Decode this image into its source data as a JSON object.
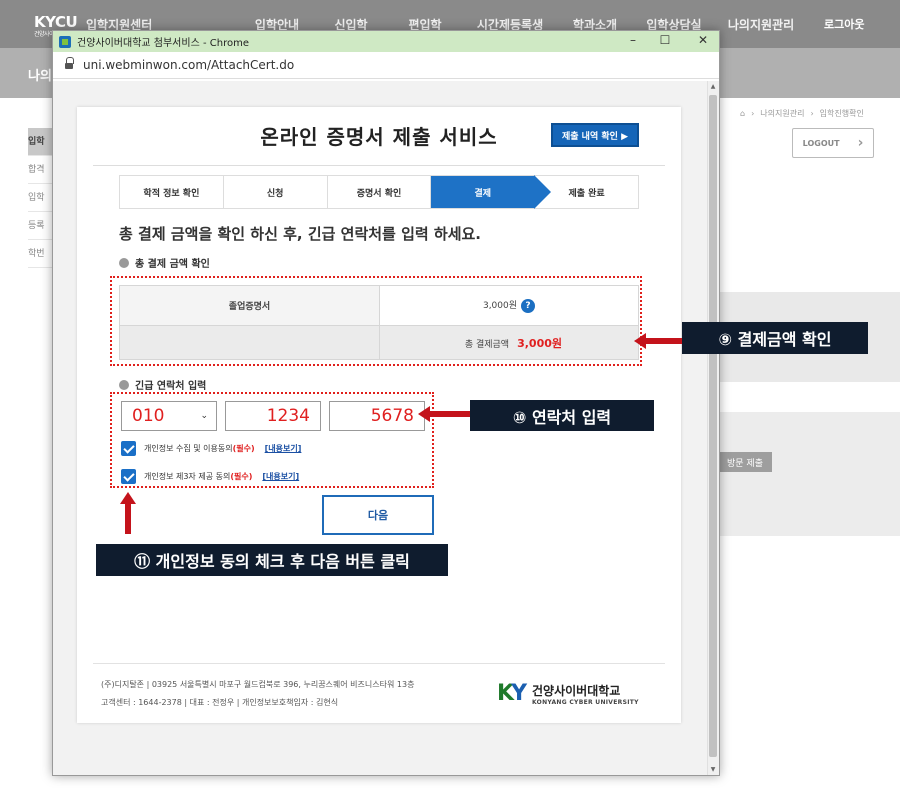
{
  "site": {
    "logo_text": "KYCU",
    "logo_sub": "건양사이버대학교",
    "center_title": "입학지원센터",
    "menu": [
      "입학안내",
      "신입학",
      "편입학",
      "시간제등록생",
      "학과소개",
      "입학상담실",
      "나의지원관리"
    ],
    "logout_label": "로그아웃",
    "band_title": "나의",
    "breadcrumb": [
      "나의지원관리",
      "입학진행확인"
    ],
    "logout_button": "LOGOUT",
    "side_items": [
      "입학",
      "합격",
      "입학",
      "등록",
      "학번"
    ],
    "submit_button": "방문 제출"
  },
  "window": {
    "title": "건양사이버대학교 첨부서비스 - Chrome",
    "url": "uni.webminwon.com/AttachCert.do",
    "minimize": "–",
    "maximize": "☐",
    "close": "✕"
  },
  "page": {
    "title": "온라인 증명서 제출 서비스",
    "history_button": "제출 내역 확인 ▶",
    "steps": [
      "학적 정보 확인",
      "신청",
      "증명서 확인",
      "결제",
      "제출 완료"
    ],
    "active_step": 3,
    "instruction": "총 결제 금액을 확인 하신 후, 긴급 연락처를 입력 하세요.",
    "amount_section": "총 결제 금액 확인",
    "rows": [
      {
        "label": "졸업증명서",
        "value": "3,000원"
      }
    ],
    "total_label": "총 결제금액",
    "total_value": "3,000원",
    "contact_section": "긴급 연락처 입력",
    "phone": {
      "prefix": "010",
      "middle": "1234",
      "last": "5678"
    },
    "agreements": [
      {
        "text": "개인정보 수집 및 이용동의",
        "required": "(필수)",
        "link": "[내용보기]"
      },
      {
        "text": "개인정보 제3자 제공 동의",
        "required": "(필수)",
        "link": "[내용보기]"
      }
    ],
    "next_button": "다음",
    "footer_line1": "(주)디지탈존 | 03925 서울특별시 마포구 월드컵북로 396, 누리꿈스퀘어 비즈니스타워 13층",
    "footer_line2": "고객센터 : 1644-2378 | 대표 : 전정우 | 개인정보보호책임자 : 김현식",
    "brand_ko": "건양사이버대학교",
    "brand_en": "KONYANG CYBER UNIVERSITY"
  },
  "callouts": {
    "c9": "⑨ 결제금액 확인",
    "c10": "⑩ 연락처 입력",
    "c11": "⑪ 개인정보 동의 체크 후 다음 버튼 클릭"
  },
  "colors": {
    "accent": "#1e72c6",
    "highlight": "#e02020",
    "callout_bg": "#0f1c2e",
    "arrow": "#c4131b"
  }
}
